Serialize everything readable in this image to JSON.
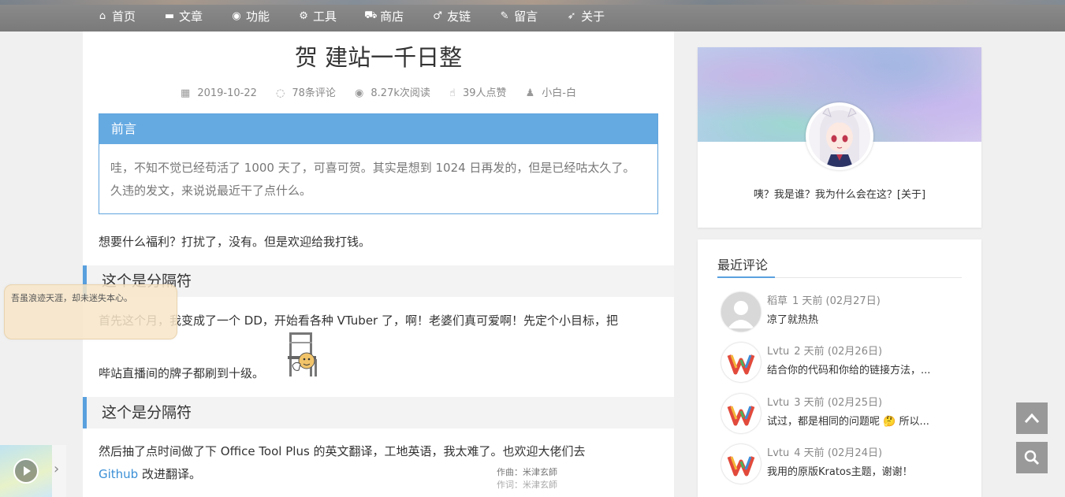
{
  "nav": [
    {
      "icon": "home-icon",
      "glyph": "⌂",
      "label": "首页"
    },
    {
      "icon": "article-icon",
      "glyph": "▬",
      "label": "文章"
    },
    {
      "icon": "dashboard-icon",
      "glyph": "◉",
      "label": "功能"
    },
    {
      "icon": "cogs-icon",
      "glyph": "⚙",
      "label": "工具"
    },
    {
      "icon": "cart-icon",
      "glyph": "⛟",
      "label": "商店"
    },
    {
      "icon": "male-icon",
      "glyph": "♂",
      "label": "友链"
    },
    {
      "icon": "pencil-icon",
      "glyph": "✎",
      "label": "留言"
    },
    {
      "icon": "rocket-icon",
      "glyph": "➶",
      "label": "关于"
    }
  ],
  "article": {
    "title": "贺 建站一千日整",
    "meta": {
      "date": "2019-10-22",
      "comments": "78条评论",
      "views": "8.27k次阅读",
      "likes": "39人点赞",
      "author": "小白-白"
    },
    "preface_title": "前言",
    "preface_text": "哇，不知不觉已经苟活了 1000 天了，可喜可贺。其实是想到 1024 日再发的，但是已经咕太久了。久违的发文，来说说最近干了点什么。",
    "para1": "想要什么福利？打扰了，没有。但是欢迎给我打钱。",
    "separator1": "这个是分隔符",
    "para2_line1": "首先这个月，我变成了一个 DD，开始看各种 VTuber 了，啊！老婆们真可爱啊！先定个小目标，把",
    "para2_line2": "哔站直播间的牌子都刷到十级。",
    "separator2": "这个是分隔符",
    "para3_line1": "然后抽了点时间做了下 Office Tool Plus 的英文翻译，工地英语，我太难了。也欢迎大佬们去",
    "para3_link": "Github",
    "para3_rest": " 改进翻译。",
    "lyric1": "作曲：米津玄師",
    "lyric2": "作词：米津玄師"
  },
  "tip": "吾虽浪迹天涯，却未迷失本心。",
  "sidebar": {
    "bio": "咦？我是谁？我为什么会在这？[关于]",
    "comments_title": "最近评论",
    "comments": [
      {
        "name": "稻草",
        "time": "1 天前 (02月27日)",
        "text": "凉了就热热"
      },
      {
        "name": "Lvtu",
        "time": "2 天前 (02月26日)",
        "text": "结合你的代码和你给的链接方法，..."
      },
      {
        "name": "Lvtu",
        "time": "3 天前 (02月25日)",
        "text": "试过，都是相同的问题呢 🤔 所以..."
      },
      {
        "name": "Lvtu",
        "time": "4 天前 (02月24日)",
        "text": "我用的原版Kratos主题，谢谢！"
      }
    ]
  }
}
